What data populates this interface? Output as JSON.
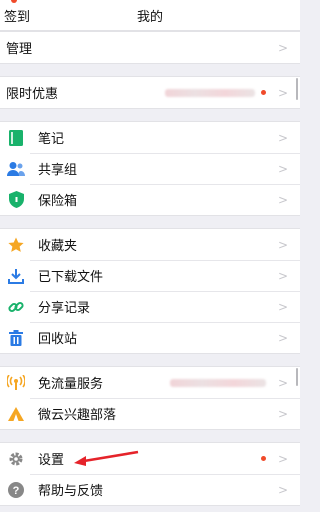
{
  "header": {
    "left": "签到",
    "title": "我的"
  },
  "rows": {
    "manage": "管理",
    "promo": "限时优惠",
    "notes": "笔记",
    "share_group": "共享组",
    "vault": "保险箱",
    "favorites": "收藏夹",
    "downloads": "已下载文件",
    "share_record": "分享记录",
    "recycle": "回收站",
    "free_flow": "免流量服务",
    "tribe": "微云兴趣部落",
    "settings": "设置",
    "help": "帮助与反馈"
  },
  "chevron": ">",
  "icons": {
    "notes": "notebook-icon",
    "share_group": "users-icon",
    "vault": "shield-icon",
    "favorites": "star-icon",
    "downloads": "download-icon",
    "share_record": "link-icon",
    "recycle": "trash-icon",
    "free_flow": "signal-icon",
    "tribe": "camp-icon",
    "settings": "gear-icon",
    "help": "question-icon"
  },
  "colors": {
    "accent_blue": "#2b7be4",
    "green": "#19b26b",
    "orange": "#f5a623",
    "red": "#e5232a"
  }
}
